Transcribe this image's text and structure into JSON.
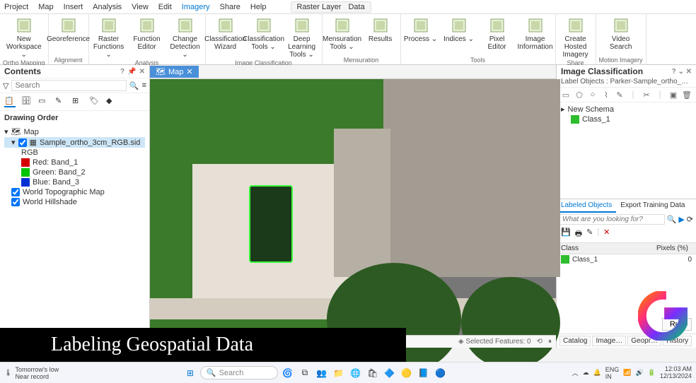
{
  "menu": {
    "items": [
      "Project",
      "Map",
      "Insert",
      "Analysis",
      "View",
      "Edit",
      "Imagery",
      "Share",
      "Help"
    ],
    "active_index": 6,
    "context": [
      "Raster Layer",
      "Data"
    ]
  },
  "ribbon": {
    "groups": [
      {
        "label": "Ortho Mapping",
        "buttons": [
          {
            "label": "New Workspace ⌄"
          }
        ]
      },
      {
        "label": "Alignment",
        "buttons": [
          {
            "label": "Georeference"
          }
        ]
      },
      {
        "label": "Analysis",
        "buttons": [
          {
            "label": "Raster Functions ⌄"
          },
          {
            "label": "Function Editor"
          },
          {
            "label": "Change Detection ⌄"
          }
        ]
      },
      {
        "label": "Image Classification",
        "buttons": [
          {
            "label": "Classification Wizard"
          },
          {
            "label": "Classification Tools ⌄"
          },
          {
            "label": "Deep Learning Tools ⌄"
          }
        ]
      },
      {
        "label": "Mensuration",
        "buttons": [
          {
            "label": "Mensuration Tools ⌄"
          },
          {
            "label": "Results"
          }
        ]
      },
      {
        "label": "Tools",
        "buttons": [
          {
            "label": "Process ⌄"
          },
          {
            "label": "Indices ⌄"
          },
          {
            "label": "Pixel Editor"
          },
          {
            "label": "Image Information"
          }
        ]
      },
      {
        "label": "Share",
        "buttons": [
          {
            "label": "Create Hosted Imagery"
          }
        ]
      },
      {
        "label": "Motion Imagery",
        "buttons": [
          {
            "label": "Video Search"
          }
        ]
      }
    ]
  },
  "contents": {
    "title": "Contents",
    "search_placeholder": "Search",
    "section": "Drawing Order",
    "map_node": "Map",
    "selected_layer": "Sample_ortho_3cm_RGB.sid",
    "rgb_label": "RGB",
    "bands": [
      {
        "color": "#d40000",
        "label": "Red: Band_1"
      },
      {
        "color": "#00c400",
        "label": "Green: Band_2"
      },
      {
        "color": "#0030d4",
        "label": "Blue: Band_3"
      }
    ],
    "basemaps": [
      {
        "checked": true,
        "label": "World Topographic Map"
      },
      {
        "checked": true,
        "label": "World Hillshade"
      }
    ]
  },
  "map_tab": {
    "label": "Map"
  },
  "map_status": {
    "selected": "Selected Features: 0"
  },
  "image_class": {
    "title": "Image Classification",
    "subtitle": "Label Objects : Parker-Sample_ortho_3c…",
    "schema_label": "New Schema",
    "classes": [
      {
        "color": "#2dbd2d",
        "name": "Class_1"
      }
    ]
  },
  "labeled": {
    "tabs": [
      "Labeled Objects",
      "Export Training Data"
    ],
    "search_placeholder": "What are you looking for?",
    "columns": [
      "Class",
      "Pixels (%)"
    ],
    "rows": [
      {
        "color": "#2dbd2d",
        "name": "Class_1",
        "pct": "0"
      }
    ],
    "run": "Run"
  },
  "bottom_tabs": [
    "Catalog",
    "Image…",
    "Geopr…",
    "History"
  ],
  "caption": "Labeling Geospatial Data",
  "taskbar": {
    "weather": {
      "line1": "Tomorrow's low",
      "line2": "Near record"
    },
    "search_placeholder": "Search",
    "lang": "ENG",
    "region": "IN",
    "time": "12:03 AM",
    "date": "12/13/2024"
  }
}
